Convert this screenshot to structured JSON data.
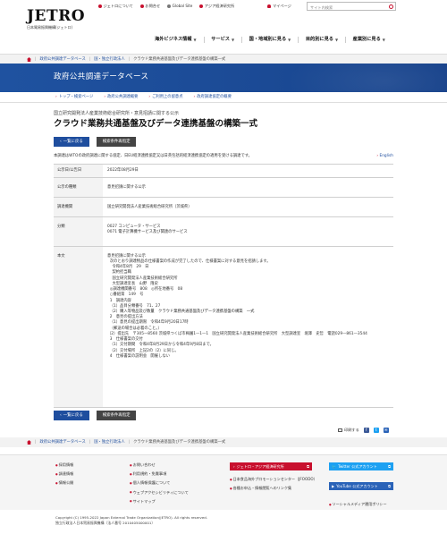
{
  "header": {
    "logo_text": "JETRO",
    "logo_subtitle": "日本貿易振興機構(ジェトロ)",
    "utility_links": [
      "ジェトロについて",
      "お問合せ",
      "Global Site",
      "アジア経済研究所"
    ],
    "mypage_label": "マイページ",
    "search_placeholder": "サイト内検索",
    "main_nav": [
      "海外ビジネス情報",
      "サービス",
      "国・地域別に見る",
      "目的別に見る",
      "産業別に見る"
    ]
  },
  "breadcrumb": {
    "items": [
      "政府公共調達データベース",
      "国・独立行政法人",
      "クラウド業務共通基盤及びデータ連携基盤の構築一式"
    ]
  },
  "banner": {
    "title": "政府公共調達データベース"
  },
  "subnav": [
    "トップ・検索ページ",
    "政府公共調達概要",
    "ご利用上の留意点",
    "政府調達協定の概要"
  ],
  "page": {
    "subtitle": "国立研究開発法人産業技術総合研究所・意見招請に関する公示",
    "title": "クラウド業務共通基盤及びデータ連携基盤の構築一式",
    "back_button": "一覧に戻る",
    "search_button": "検索条件再指定",
    "notice": "本調達はWTOの政府調達に関する協定、日EU経済連携協定又は日英包括的経済連携協定の適用を受ける調達です。",
    "english_link": "English"
  },
  "detail": {
    "rows": [
      {
        "label": "公示日/公告日",
        "value": "2022年08月29日"
      },
      {
        "label": "公示の種類",
        "value": "意見招請に関する公示"
      },
      {
        "label": "調達機関",
        "value": "国立研究開発法人産業技術総合研究所（茨城県）"
      },
      {
        "label": "分類",
        "value": "0027 コンピュータ・サービス\n0071 電子計算機サービス及び関連のサービス"
      }
    ],
    "body_label": "本文",
    "body_lines": [
      "意見招請に関する公示",
      "  次のとおり調達物品の仕様書案の作成が完了したので、仕様書案に対する意見を招請します。",
      "    令和4年8月　29　日",
      "    契約担当職",
      "    国立研究開発法人産業技術総合研究所",
      "    大型調達室長　山野　隆史",
      "  ◎調達機関番号　808　◎所在地番号　08",
      "  ○番組第　149　号",
      "  1　調達内容",
      "  （1）品目分類番号　71、27",
      "  （2）購入等物品及び数量　クラウド業務共通基盤及びデータ連携基盤の構築　一式",
      "  2　意見の提出方法",
      "  （1）意見の提出期限　令和4年9月20日17時",
      "  （郵送の場合は必着のこと。）",
      "  （2）提出先　〒305—8560 茨城県つくば市梅園1—1—1　国立研究開発法人産業技術総合研究所　大型調達室　堀澤　史哲　電話029—861—3544",
      "  3　仕様書案の交付",
      "  （1）交付期間　令和4年8月29日から令和4年9月8日まで。",
      "  （2）交付場所　上記2の（2）に同じ。",
      "  4　仕様書案の説明会　開催しない"
    ]
  },
  "bottom_buttons": {
    "back": "一覧に戻る",
    "search": "検索条件再指定"
  },
  "tools": {
    "print": "印刷する"
  },
  "footer": {
    "col1": [
      "採用情報",
      "調達情報",
      "情報公開"
    ],
    "col2": [
      "お問い合わせ",
      "利用規約・免責事項",
      "個人情報保護について",
      "ウェブアクセシビリティについて",
      "サイトマップ"
    ],
    "jetro_button": "ジェトロ・アジア経済研究所",
    "col3": [
      "日本食品海外プロモーションセンター（JFOODO）",
      "各種お申込・情報閲覧へのリンク集"
    ],
    "twitter_button": "Twitter 公式アカウント",
    "youtube_button": "YouTube 公式アカウント",
    "sns_note": "ソーシャルメディア運用ポリシー"
  },
  "copyright": [
    "Copyright (C) 1995-2022 Japan External Trade Organization(JETRO). All rights reserved.",
    "独立行政法人日本貿易振興機構（法人番号 2010405000001）"
  ],
  "colors": {
    "brand_red": "#c8102e",
    "banner_blue": "#1f52a0",
    "link_blue": "#1f4e9e"
  }
}
